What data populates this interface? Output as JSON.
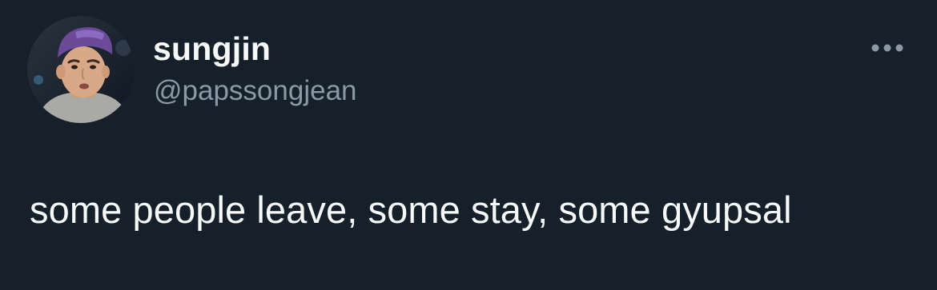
{
  "tweet": {
    "author": {
      "display_name": "sungjin",
      "handle": "@papssongjean",
      "avatar_icon": "profile-photo"
    },
    "text": "some people leave, some stay, some gyupsal",
    "more_icon": "more-horizontal-icon"
  },
  "colors": {
    "background": "#15202b",
    "primary_text": "#f7f9f9",
    "secondary_text": "#8b98a5"
  }
}
